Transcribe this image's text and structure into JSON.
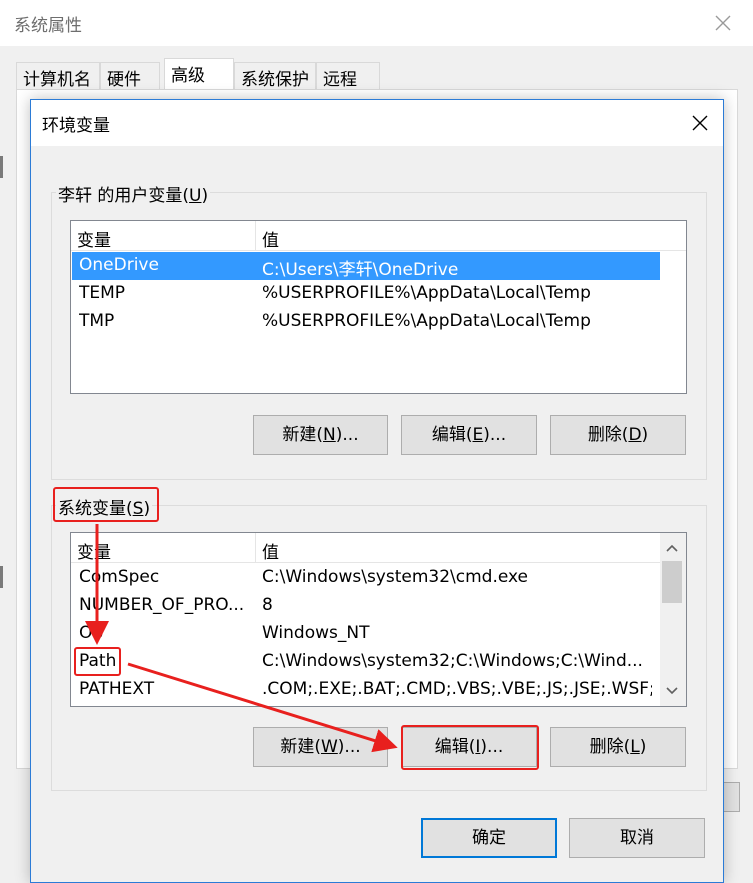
{
  "system_properties": {
    "title": "系统属性",
    "tabs": [
      {
        "label": "计算机名"
      },
      {
        "label": "硬件"
      },
      {
        "label": "高级"
      },
      {
        "label": "系统保护"
      },
      {
        "label": "远程"
      }
    ],
    "active_tab": "高级"
  },
  "env_dialog": {
    "title": "环境变量",
    "user_group": {
      "label_prefix": "李轩 的用户变量(",
      "label_key": "U",
      "label_suffix": ")",
      "columns": [
        "变量",
        "值"
      ],
      "rows": [
        {
          "name": "OneDrive",
          "value": "C:\\Users\\李轩\\OneDrive",
          "selected": true
        },
        {
          "name": "TEMP",
          "value": "%USERPROFILE%\\AppData\\Local\\Temp"
        },
        {
          "name": "TMP",
          "value": "%USERPROFILE%\\AppData\\Local\\Temp"
        }
      ],
      "buttons": {
        "new": {
          "prefix": "新建(",
          "key": "N",
          "suffix": ")..."
        },
        "edit": {
          "prefix": "编辑(",
          "key": "E",
          "suffix": ")..."
        },
        "delete": {
          "prefix": "删除(",
          "key": "D",
          "suffix": ")"
        }
      }
    },
    "system_group": {
      "label_prefix": "系统变量(",
      "label_key": "S",
      "label_suffix": ")",
      "columns": [
        "变量",
        "值"
      ],
      "rows": [
        {
          "name": "ComSpec",
          "value": "C:\\Windows\\system32\\cmd.exe"
        },
        {
          "name": "NUMBER_OF_PRO...",
          "value": "8"
        },
        {
          "name": "OS",
          "value": "Windows_NT"
        },
        {
          "name": "Path",
          "value": "C:\\Windows\\system32;C:\\Windows;C:\\Wind..."
        },
        {
          "name": "PATHEXT",
          "value": ".COM;.EXE;.BAT;.CMD;.VBS;.VBE;.JS;.JSE;.WSF;..."
        }
      ],
      "buttons": {
        "new": {
          "prefix": "新建(",
          "key": "W",
          "suffix": ")..."
        },
        "edit": {
          "prefix": "编辑(",
          "key": "I",
          "suffix": ")..."
        },
        "delete": {
          "prefix": "删除(",
          "key": "L",
          "suffix": ")"
        }
      }
    },
    "ok_label": "确定",
    "cancel_label": "取消"
  },
  "annotation_color": "#e8201e",
  "selection_color": "#3399ff",
  "icons": [
    "close-icon",
    "scroll-up-arrow-icon",
    "scroll-down-arrow-icon"
  ]
}
